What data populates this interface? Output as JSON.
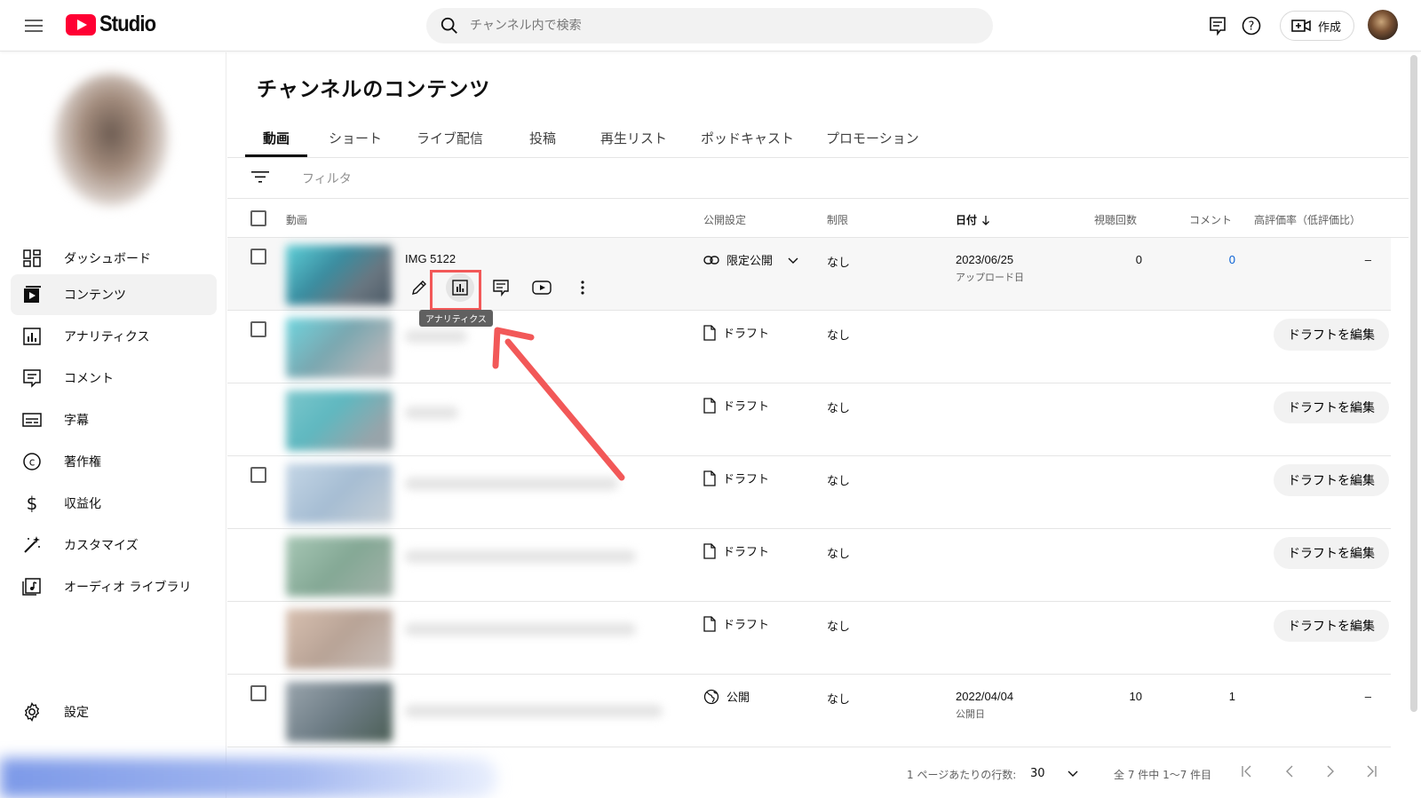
{
  "app": {
    "logo_text": "Studio",
    "brand_red": "#ff0033"
  },
  "search": {
    "placeholder": "チャンネル内で検索"
  },
  "topbar": {
    "create_label": "作成"
  },
  "sidebar": {
    "items": [
      {
        "label": "ダッシュボード",
        "icon": "dashboard-icon"
      },
      {
        "label": "コンテンツ",
        "icon": "content-icon",
        "active": true
      },
      {
        "label": "アナリティクス",
        "icon": "analytics-icon"
      },
      {
        "label": "コメント",
        "icon": "comment-icon"
      },
      {
        "label": "字幕",
        "icon": "subtitles-icon"
      },
      {
        "label": "著作権",
        "icon": "copyright-icon"
      },
      {
        "label": "収益化",
        "icon": "monetization-icon"
      },
      {
        "label": "カスタマイズ",
        "icon": "customize-icon"
      },
      {
        "label": "オーディオ ライブラリ",
        "icon": "audio-library-icon"
      }
    ],
    "settings_label": "設定"
  },
  "page": {
    "title": "チャンネルのコンテンツ",
    "tabs": [
      "動画",
      "ショート",
      "ライブ配信",
      "投稿",
      "再生リスト",
      "ポッドキャスト",
      "プロモーション"
    ],
    "filter_label": "フィルタ"
  },
  "table": {
    "headers": {
      "video": "動画",
      "visibility": "公開設定",
      "restriction": "制限",
      "date": "日付",
      "views": "視聴回数",
      "comments": "コメント",
      "likes": "高評価率（低評価比）"
    },
    "rows": [
      {
        "title": "IMG 5122",
        "visibility": "限定公開",
        "restriction": "なし",
        "date": "2023/06/25",
        "date_sub": "アップロード日",
        "views": "0",
        "comments": "0",
        "likes": "–"
      },
      {
        "visibility": "ドラフト",
        "restriction": "なし",
        "draft_button": "ドラフトを編集"
      },
      {
        "visibility": "ドラフト",
        "restriction": "なし",
        "draft_button": "ドラフトを編集"
      },
      {
        "visibility": "ドラフト",
        "restriction": "なし",
        "draft_button": "ドラフトを編集"
      },
      {
        "visibility": "ドラフト",
        "restriction": "なし",
        "draft_button": "ドラフトを編集"
      },
      {
        "visibility": "ドラフト",
        "restriction": "なし",
        "draft_button": "ドラフトを編集"
      },
      {
        "visibility": "公開",
        "restriction": "なし",
        "date": "2022/04/04",
        "date_sub": "公開日",
        "views": "10",
        "comments": "1",
        "likes": "–"
      }
    ],
    "tooltip": "アナリティクス"
  },
  "footer": {
    "rows_per_page_label": "1 ページあたりの行数:",
    "rows_per_page_value": "30",
    "range_text": "全 7 件中 1〜7 件目"
  },
  "colors": {
    "highlight": "#f25858",
    "link_blue": "#065fd4"
  }
}
